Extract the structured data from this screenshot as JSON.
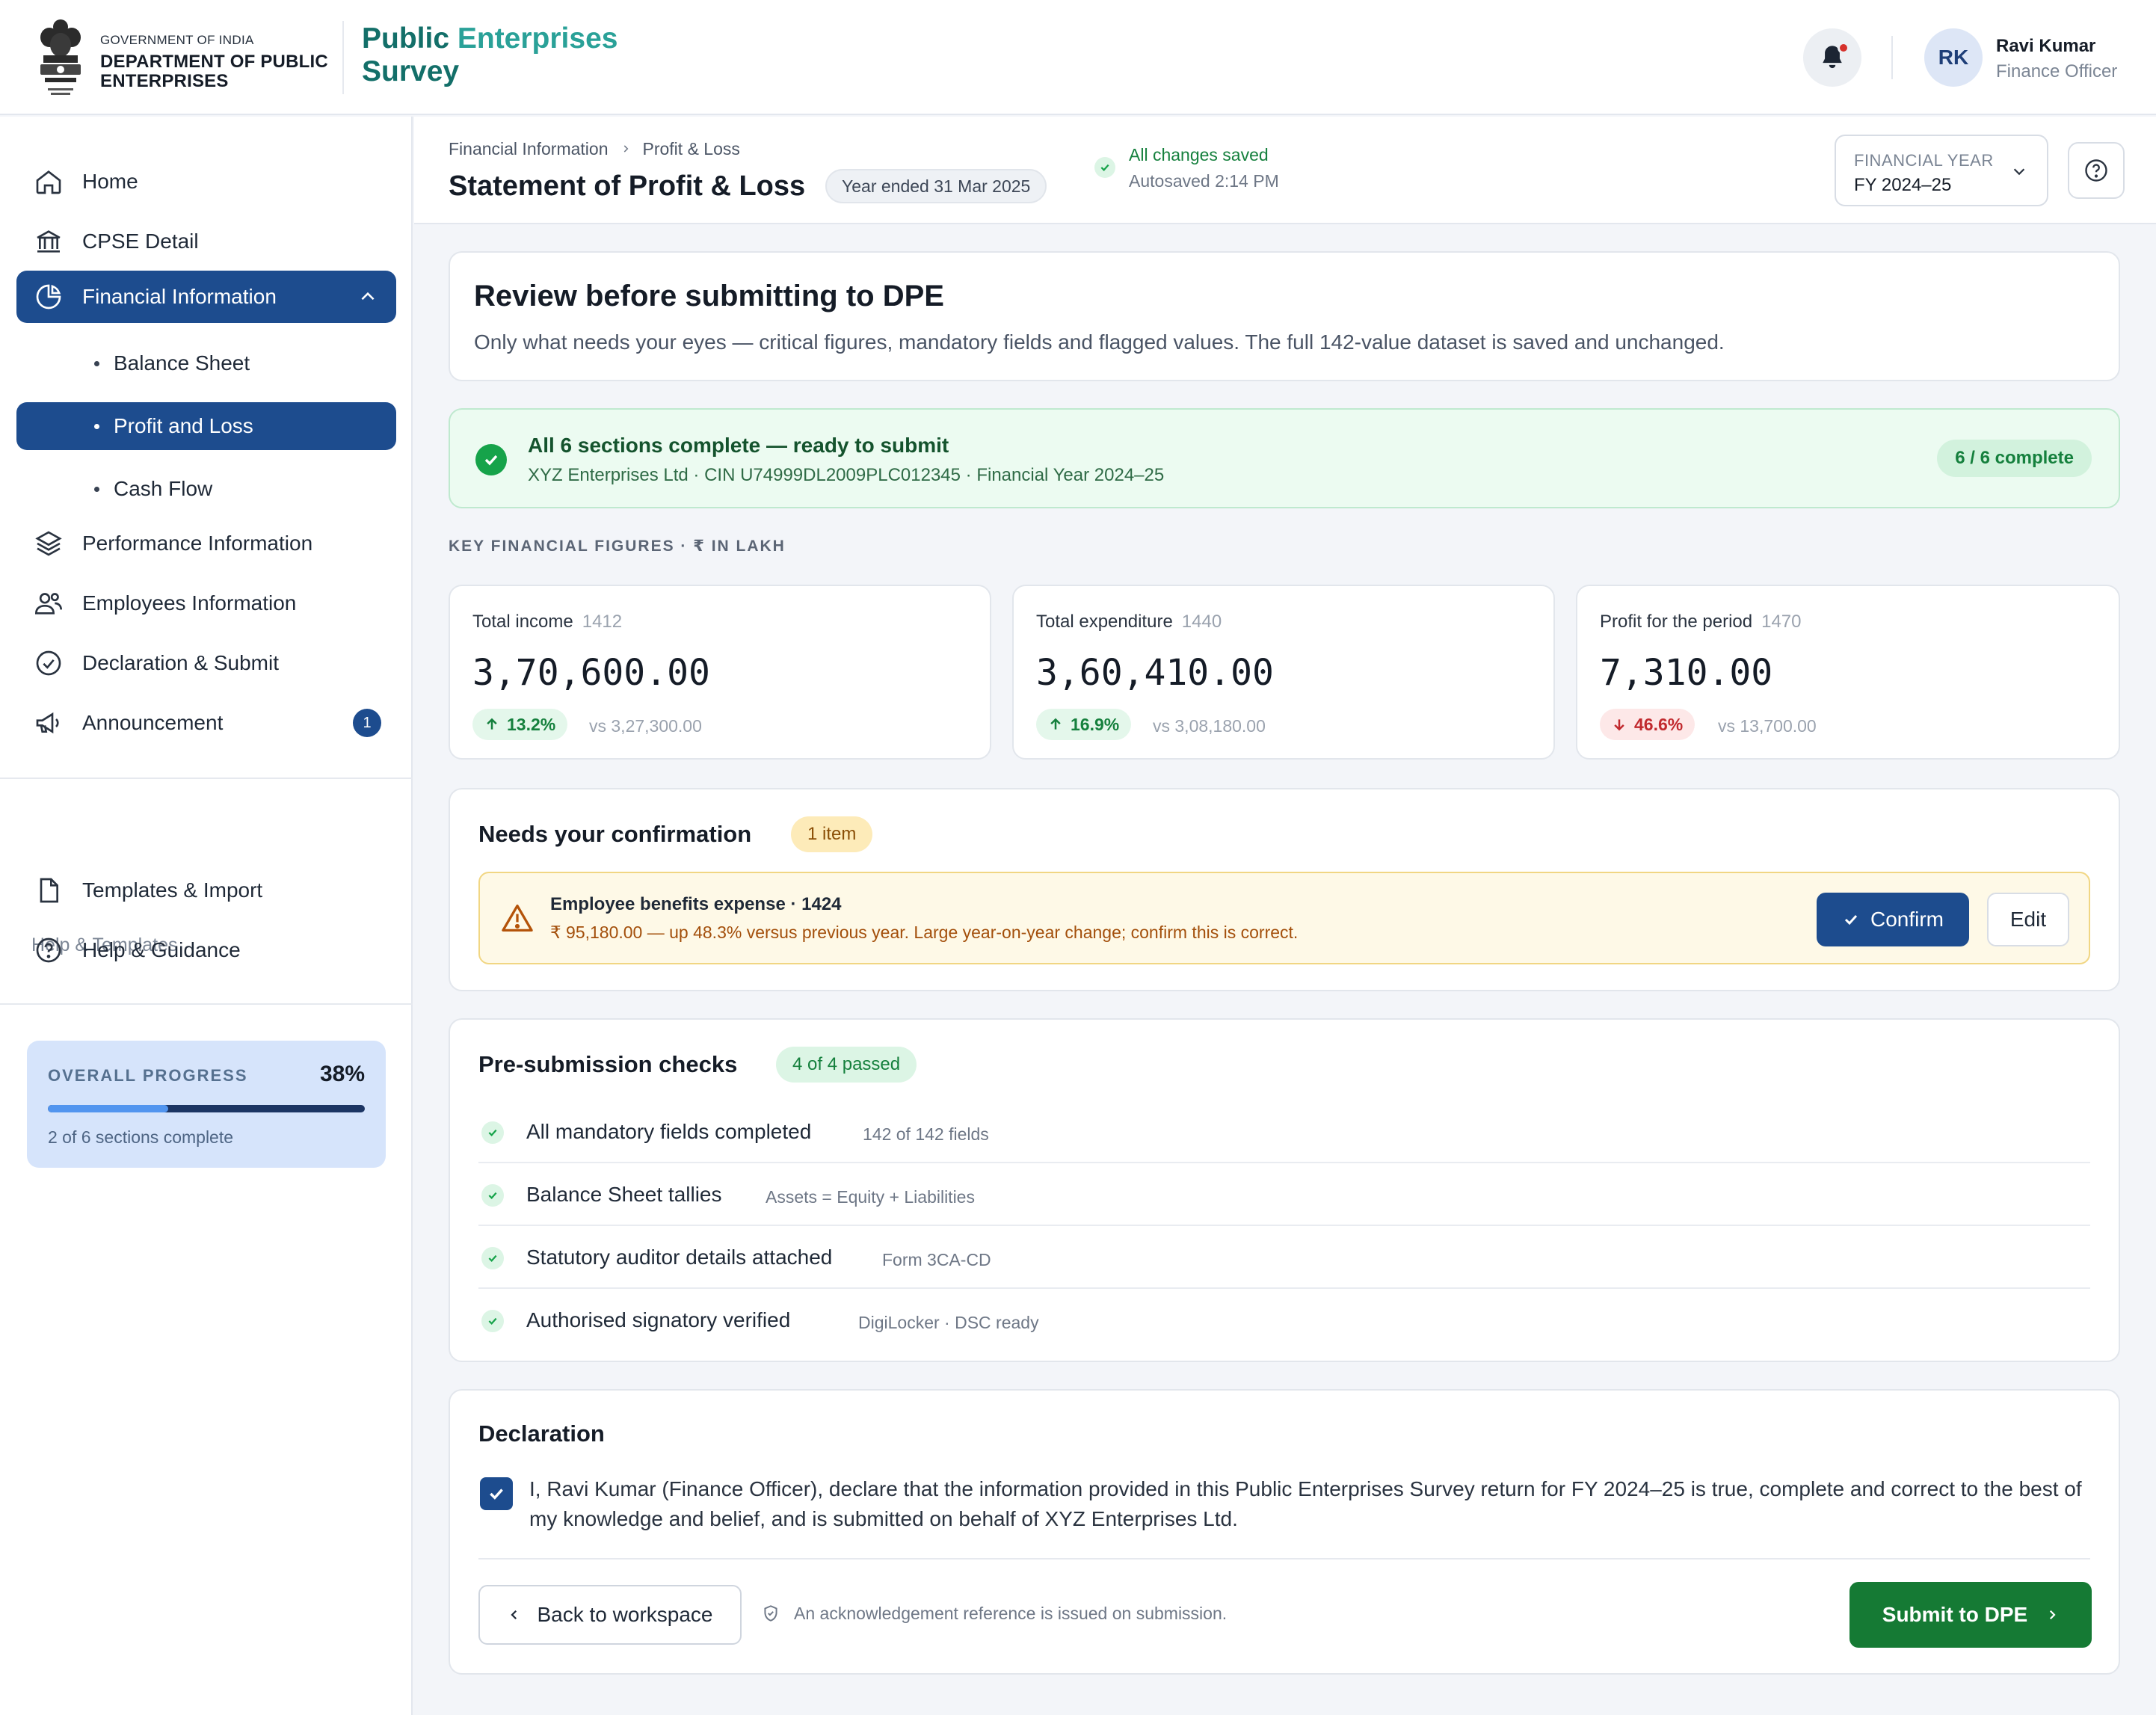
{
  "header": {
    "gov_line": "GOVERNMENT OF INDIA",
    "dept_line": "DEPARTMENT OF PUBLIC ENTERPRISES",
    "app_title_a": "Public ",
    "app_title_b": "Enterprises",
    "app_title_c": "Survey",
    "emblem_icon": "state-emblem-icon",
    "notification_icon": "bell-icon",
    "user": {
      "initials": "RK",
      "name": "Ravi Kumar",
      "role": "Finance Officer"
    }
  },
  "sidebar": {
    "nav": [
      {
        "label": "Home",
        "icon": "home-icon"
      },
      {
        "label": "CPSE Detail",
        "icon": "bank-icon"
      },
      {
        "label": "Financial Information",
        "icon": "pie-chart-icon",
        "active": true,
        "expanded": true
      },
      {
        "label": "Performance Information",
        "icon": "layers-icon"
      },
      {
        "label": "Employees Information",
        "icon": "users-icon"
      },
      {
        "label": "Declaration & Submit",
        "icon": "check-circle-icon"
      },
      {
        "label": "Announcement",
        "icon": "megaphone-icon",
        "badge": "1"
      }
    ],
    "sub_nav": [
      {
        "label": "Balance Sheet"
      },
      {
        "label": "Profit and Loss",
        "active": true
      },
      {
        "label": "Cash Flow"
      }
    ],
    "help_section_label": "Help & Templates",
    "help_nav": [
      {
        "label": "Templates & Import",
        "icon": "file-icon"
      },
      {
        "label": "Help & Guidance",
        "icon": "help-circle-icon"
      }
    ],
    "progress": {
      "label": "OVERALL PROGRESS",
      "percent_text": "38%",
      "value": 0.38,
      "subtitle": "2 of 6 sections complete"
    }
  },
  "page": {
    "breadcrumb": [
      "Financial Information",
      "Profit & Loss"
    ],
    "title": "Statement of Profit & Loss",
    "year_pill": "Year ended 31 Mar 2025",
    "save_status": "All changes saved",
    "autosaved": "Autosaved 2:14 PM",
    "fy_select": {
      "caption": "FINANCIAL YEAR",
      "value": "FY 2024–25"
    }
  },
  "review": {
    "title": "Review before submitting to DPE",
    "description": "Only what needs your eyes — critical figures, mandatory fields and flagged values. The full 142-value dataset is saved and unchanged."
  },
  "ready": {
    "title": "All 6 sections complete — ready to submit",
    "subtitle": "XYZ Enterprises Ltd · CIN U74999DL2009PLC012345 · Financial Year 2024–25",
    "pill": "6 / 6 complete"
  },
  "key_figures": {
    "label": "KEY FINANCIAL FIGURES · ₹ IN LAKH",
    "items": [
      {
        "title": "Total income",
        "code": "1412",
        "value": "3,70,600.00",
        "change": "13.2%",
        "direction": "up",
        "previous": "vs 3,27,300.00"
      },
      {
        "title": "Total expenditure",
        "code": "1440",
        "value": "3,60,410.00",
        "change": "16.9%",
        "direction": "up",
        "previous": "vs 3,08,180.00"
      },
      {
        "title": "Profit for the period",
        "code": "1470",
        "value": "7,310.00",
        "change": "46.6%",
        "direction": "down",
        "previous": "vs 13,700.00"
      }
    ]
  },
  "confirmation": {
    "title": "Needs your confirmation",
    "count": "1 item",
    "item": {
      "title": "Employee benefits expense · 1424",
      "detail": "₹ 95,180.00 — up 48.3% versus previous year. Large year-on-year change; confirm this is correct.",
      "confirm_label": "Confirm",
      "edit_label": "Edit"
    }
  },
  "checks": {
    "title": "Pre-submission checks",
    "count": "4 of 4 passed",
    "items": [
      {
        "label": "All mandatory fields completed",
        "detail": "142 of 142 fields"
      },
      {
        "label": "Balance Sheet tallies",
        "detail": "Assets = Equity + Liabilities"
      },
      {
        "label": "Statutory auditor details attached",
        "detail": "Form 3CA-CD"
      },
      {
        "label": "Authorised signatory verified",
        "detail": "DigiLocker · DSC ready"
      }
    ]
  },
  "declaration": {
    "title": "Declaration",
    "checked": true,
    "text": "I, Ravi Kumar (Finance Officer), declare that the information provided in this Public Enterprises Survey return for FY 2024–25 is true, complete and correct to the best of my knowledge and belief, and is submitted on behalf of XYZ Enterprises Ltd.",
    "back_label": "Back to workspace",
    "ack_text": "An acknowledgement reference is issued on submission.",
    "submit_label": "Submit to DPE"
  },
  "colors": {
    "primary": "#1d4c8e",
    "success": "#157a34",
    "brand": "#136f69",
    "warning_bg": "#fef9e7",
    "danger": "#c1292e"
  }
}
